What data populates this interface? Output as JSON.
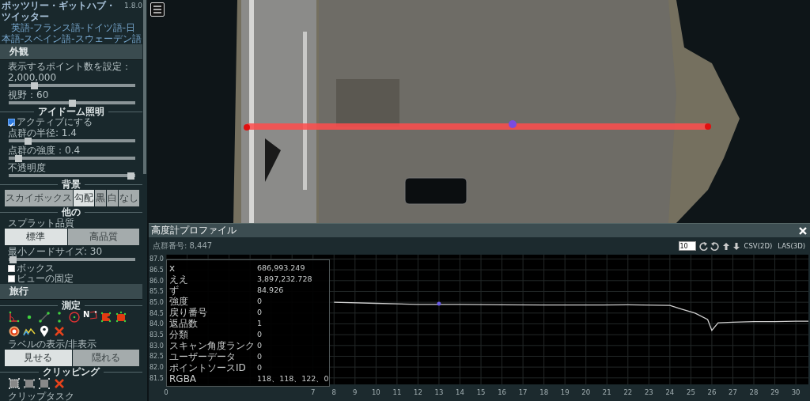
{
  "sidebar": {
    "title": "ポッツリー・ギットハブ・ツイッター",
    "version": "1.8.0",
    "languages": "英語-フランス語-ドイツ語-日本語-スペイン語-スウェーデン語",
    "items": [
      {
        "kind": "bar",
        "label": "外観"
      },
      {
        "kind": "slider",
        "label": "表示するポイント数を設定：2,000,000",
        "level": 0.18
      },
      {
        "kind": "slider",
        "label": "視野：60",
        "level": 0.5
      },
      {
        "kind": "divider",
        "label": "アイドーム照明"
      },
      {
        "kind": "checkbox",
        "label": "アクティブにする",
        "checked": true
      },
      {
        "kind": "slider",
        "label": "点群の半径: 1.4",
        "level": 0.13
      },
      {
        "kind": "slider",
        "label": "点群の強度：0.4",
        "level": 0.05
      },
      {
        "kind": "slider",
        "label": "不透明度",
        "level": 1
      },
      {
        "kind": "divider",
        "label": "背景"
      },
      {
        "kind": "buttons",
        "options": [
          {
            "label": "スカイボックス",
            "selected": false
          },
          {
            "label": "勾配",
            "selected": true
          },
          {
            "label": "黒",
            "selected": false
          },
          {
            "label": "白",
            "selected": false
          },
          {
            "label": "なし",
            "selected": false
          }
        ]
      },
      {
        "kind": "divider",
        "label": "他の"
      },
      {
        "kind": "label",
        "label": "スプラット品質"
      },
      {
        "kind": "buttons",
        "options": [
          {
            "label": "標準",
            "selected": true
          },
          {
            "label": "高品質",
            "selected": false
          }
        ]
      },
      {
        "kind": "slider",
        "label": "最小ノードサイズ: 30",
        "level": 0
      },
      {
        "kind": "checkbox",
        "label": "ボックス",
        "checked": false
      },
      {
        "kind": "checkbox",
        "label": "ビューの固定",
        "checked": false
      },
      {
        "kind": "bar",
        "label": "旅行"
      },
      {
        "kind": "divider",
        "label": "測定"
      },
      {
        "kind": "measure-tools",
        "north_label": "N"
      },
      {
        "kind": "label",
        "label": "ラベルの表示/非表示"
      },
      {
        "kind": "buttons",
        "options": [
          {
            "label": "見せる",
            "selected": true
          },
          {
            "label": "隠れる",
            "selected": false
          }
        ]
      },
      {
        "kind": "divider",
        "label": "クリッピング"
      },
      {
        "kind": "clip-tools"
      },
      {
        "kind": "label",
        "label": "クリップタスク"
      }
    ]
  },
  "profile": {
    "title": "高度計プロファイル",
    "point_count": "点群番号: 8,447",
    "step_value": "10",
    "export_buttons": [
      "CSV(2D)",
      "LAS(3D)"
    ],
    "point_info": [
      {
        "key": "x",
        "value": "686,993.249"
      },
      {
        "key": "ええ",
        "value": "3,897,232.728"
      },
      {
        "key": "ず",
        "value": "84.926"
      },
      {
        "key": "強度",
        "value": "0"
      },
      {
        "key": "戻り番号",
        "value": "0"
      },
      {
        "key": "返品数",
        "value": "1"
      },
      {
        "key": "分類",
        "value": "0"
      },
      {
        "key": "スキャン角度ランク",
        "value": "0"
      },
      {
        "key": "ユーザーデータ",
        "value": "0"
      },
      {
        "key": "ポイントソースID",
        "value": "0"
      },
      {
        "key": "RGBA",
        "value": "118、118、122、0"
      }
    ],
    "chart_data": {
      "type": "line",
      "grid": true,
      "x": [
        8,
        10,
        12,
        14,
        16,
        18,
        20,
        22,
        24,
        24.5,
        25.2,
        25.8,
        26,
        26.3,
        27,
        28,
        29,
        30,
        30.6
      ],
      "series": [
        {
          "color": "#cfcfcf",
          "values": [
            85.0,
            84.95,
            84.9,
            84.9,
            84.88,
            84.87,
            84.87,
            84.88,
            84.85,
            84.7,
            84.5,
            84.2,
            83.7,
            84.05,
            84.08,
            84.1,
            84.1,
            84.12,
            84.12
          ]
        }
      ],
      "xlim": [
        0,
        30.6
      ],
      "ylim": [
        81.2,
        87.2
      ],
      "xticks": [
        0,
        7,
        8,
        9,
        10,
        11,
        12,
        13,
        14,
        15,
        16,
        17,
        18,
        19,
        20,
        21,
        22,
        23,
        24,
        25,
        26,
        27,
        28,
        29,
        30
      ],
      "yticks": [
        {
          "value": 81.5,
          "label": "81.5"
        },
        {
          "value": 82,
          "label": "82.0"
        },
        {
          "value": 82.5,
          "label": "82.5"
        },
        {
          "value": 83,
          "label": "83.0"
        },
        {
          "value": 83.5,
          "label": "83.5"
        },
        {
          "value": 84,
          "label": "84.0"
        },
        {
          "value": 84.5,
          "label": "84.5"
        },
        {
          "value": 85,
          "label": "85.0"
        },
        {
          "value": 85.5,
          "label": "85.5"
        },
        {
          "value": 86,
          "label": "86.0"
        },
        {
          "value": 86.5,
          "label": "86.5"
        },
        {
          "value": 87,
          "label": "87.0"
        }
      ]
    }
  }
}
